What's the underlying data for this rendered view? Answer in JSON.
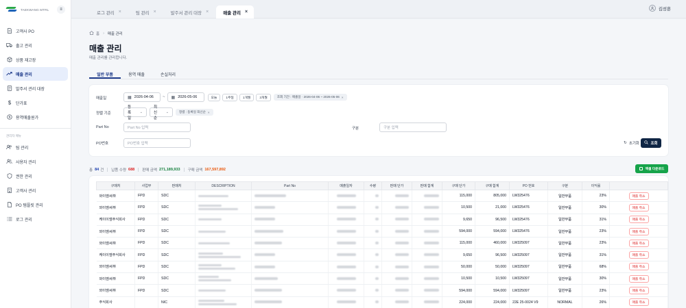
{
  "app": {
    "brand_text": "TAEKWANG MTRL",
    "logo_colors": [
      "#2aa84a",
      "#1e63b8"
    ]
  },
  "sidebar": {
    "items": [
      {
        "label": "고객사 PO",
        "icon": "document-icon"
      },
      {
        "label": "출고 관리",
        "icon": "truck-icon"
      },
      {
        "label": "상품 재고장",
        "icon": "box-icon"
      },
      {
        "label": "매출 관리",
        "icon": "trend-up-icon",
        "active": true
      },
      {
        "label": "발주서 관리 대장",
        "icon": "file-icon"
      },
      {
        "label": "단가표",
        "icon": "price-icon"
      },
      {
        "label": "용역매출원가",
        "icon": "circle-dollar-icon"
      }
    ],
    "admin_group": "관리자 메뉴",
    "admin_items": [
      {
        "label": "팀 관리",
        "icon": "team-icon"
      },
      {
        "label": "사용자 관리",
        "icon": "users-icon"
      },
      {
        "label": "권한 관리",
        "icon": "shield-icon"
      },
      {
        "label": "고객사 관리",
        "icon": "building-icon"
      },
      {
        "label": "PO 템플릿 관리",
        "icon": "template-icon"
      },
      {
        "label": "로그 관리",
        "icon": "list-icon"
      }
    ]
  },
  "topbar": {
    "tabs": [
      {
        "label": "로그 관리"
      },
      {
        "label": "팀 관리"
      },
      {
        "label": "발주서 관리 대장"
      },
      {
        "label": "매출 관리",
        "active": true
      }
    ],
    "user_name": "김성훈"
  },
  "breadcrumb": {
    "home": "홈",
    "current": "매출 관리"
  },
  "page": {
    "title": "매출 관리",
    "subtitle": "매출 관리를 관리합니다."
  },
  "subtabs": [
    {
      "label": "일반 부품",
      "active": true
    },
    {
      "label": "용역 매출"
    },
    {
      "label": "손실처리"
    }
  ],
  "filter": {
    "date_label": "매출일",
    "date_from": "2026-04-06",
    "date_to": "2026-05-06",
    "quick_ranges": [
      "오늘",
      "1주일",
      "1개월",
      "3개월"
    ],
    "period_pill": "조회 기간 : 매출일 · 2026-04-06 ~ 2026-05-06",
    "sort_label": "정렬 기준",
    "sort_field": "등록일",
    "sort_order": "최신순",
    "sort_pill": "정렬 : 등록일 최신순",
    "partno_label": "Part No",
    "partno_placeholder": "Part No 입력",
    "category_label": "구분",
    "category_placeholder": "구분 입력",
    "po_label": "PO번호",
    "po_placeholder": "PO번호 입력",
    "reset_label": "초기화",
    "search_label": "조회"
  },
  "summary": {
    "total_prefix": "총",
    "total_count": "84",
    "total_unit": "건",
    "delivered_label": "납품 수량",
    "delivered_value": "688",
    "sales_label": "판매 금액",
    "sales_value": "271,189,933",
    "purchase_label": "구매 금액",
    "purchase_value": "167,597,892",
    "excel_label": "엑셀 다운로드"
  },
  "table": {
    "columns": [
      "구매처",
      "사업부",
      "판매처",
      "DESCRIPTION",
      "Part No",
      "매출일자",
      "수량",
      "판매 단가",
      "판매 합계",
      "구매 단가",
      "구매 합계",
      "PO 번호",
      "구분",
      "이익률",
      ""
    ],
    "cancel_label": "매출 취소",
    "rows": [
      {
        "buyer": "와이엠씨㈜",
        "div": "FPD",
        "seller": "SDC",
        "unit": "115,000",
        "total": "805,000",
        "po": "LW325476",
        "cat": "일반부품",
        "margin": "23%"
      },
      {
        "buyer": "와이엠씨㈜",
        "div": "FPD",
        "seller": "SDC",
        "unit": "10,500",
        "total": "21,000",
        "po": "LW325476",
        "cat": "일반부품",
        "margin": "30%"
      },
      {
        "buyer": "케이이엠주식회사",
        "div": "FPD",
        "seller": "SDC",
        "unit": "9,650",
        "total": "96,500",
        "po": "LW325476",
        "cat": "일반부품",
        "margin": "31%"
      },
      {
        "buyer": "와이엠씨㈜",
        "div": "FPD",
        "seller": "SDC",
        "unit": "594,000",
        "total": "594,000",
        "po": "LW325476",
        "cat": "일반부품",
        "margin": "23%"
      },
      {
        "buyer": "와이엠씨㈜",
        "div": "FPD",
        "seller": "SDC",
        "unit": "115,000",
        "total": "460,000",
        "po": "LW325097",
        "cat": "일반부품",
        "margin": "23%"
      },
      {
        "buyer": "케이이엠주식회사",
        "div": "FPD",
        "seller": "SDC",
        "unit": "9,650",
        "total": "96,500",
        "po": "LW325097",
        "cat": "일반부품",
        "margin": "31%"
      },
      {
        "buyer": "와이엠씨㈜",
        "div": "FPD",
        "seller": "SDC",
        "unit": "50,000",
        "total": "50,000",
        "po": "LW325097",
        "cat": "일반부품",
        "margin": "68%"
      },
      {
        "buyer": "와이엠씨㈜",
        "div": "FPD",
        "seller": "SDC",
        "unit": "10,500",
        "total": "10,500",
        "po": "LW325097",
        "cat": "일반부품",
        "margin": "30%"
      },
      {
        "buyer": "와이엠씨㈜",
        "div": "FPD",
        "seller": "SDC",
        "unit": "594,000",
        "total": "594,000",
        "po": "LW325097",
        "cat": "일반부품",
        "margin": "23%"
      },
      {
        "buyer": "주식회사",
        "div": "",
        "seller": "NIC",
        "unit": "224,000",
        "total": "224,000",
        "po": "22E 25-0024 V9",
        "cat": "NORMAL",
        "margin": "26%"
      }
    ]
  }
}
